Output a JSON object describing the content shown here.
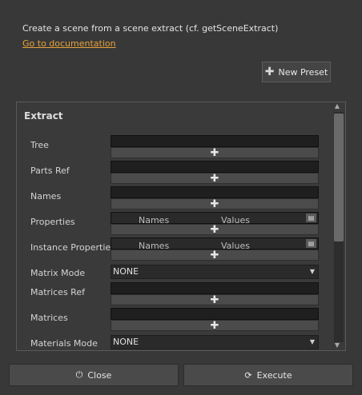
{
  "description": "Create a scene from a scene extract (cf. getSceneExtract)",
  "doc_link": "Go to documentation",
  "new_preset_label": "New Preset",
  "extract": {
    "title": "Extract",
    "tree_label": "Tree",
    "parts_ref_label": "Parts Ref",
    "names_label": "Names",
    "properties_label": "Properties",
    "properties_cols": [
      "Names",
      "Values"
    ],
    "instance_properties_label": "Instance Properties",
    "instance_properties_cols": [
      "Names",
      "Values"
    ],
    "matrix_mode_label": "Matrix Mode",
    "matrix_mode_value": "NONE",
    "matrices_ref_label": "Matrices Ref",
    "matrices_label": "Matrices",
    "materials_mode_label": "Materials Mode",
    "materials_mode_value": "NONE"
  },
  "footer": {
    "close_label": "Close",
    "execute_label": "Execute"
  },
  "icons": {
    "add": "plus-icon",
    "close": "power-icon",
    "execute": "refresh-icon"
  }
}
